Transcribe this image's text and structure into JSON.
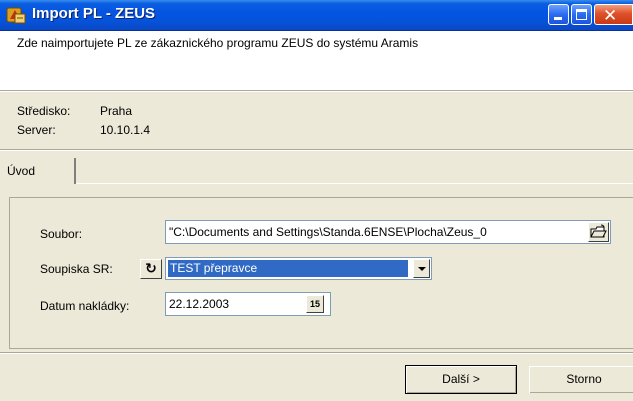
{
  "window": {
    "title": "Import PL - ZEUS",
    "icon": "zeus-app-icon",
    "controls": [
      "minimize",
      "maximize",
      "close"
    ]
  },
  "header": {
    "description": "Zde naimportujete PL ze zákaznického programu ZEUS do systému Aramis"
  },
  "info": {
    "stredisko_label": "Středisko:",
    "stredisko_value": "Praha",
    "server_label": "Server:",
    "server_value": "10.10.1.4"
  },
  "tabs": [
    {
      "label": "Úvod",
      "selected": true
    }
  ],
  "form": {
    "soubor_label": "Soubor:",
    "soubor_value": "\"C:\\Documents and Settings\\Standa.6ENSE\\Plocha\\Zeus_0",
    "soupiska_label": "Soupiska SR:",
    "soupiska_value": "TEST přepravce",
    "datum_label": "Datum nakládky:",
    "datum_value": "22.12.2003",
    "calendar_button_text": "15"
  },
  "buttons": {
    "next": "Další >",
    "cancel": "Storno"
  },
  "colors": {
    "titlebar": "#0554e3",
    "selection": "#316ac5",
    "dialog_bg": "#ece9d8"
  }
}
